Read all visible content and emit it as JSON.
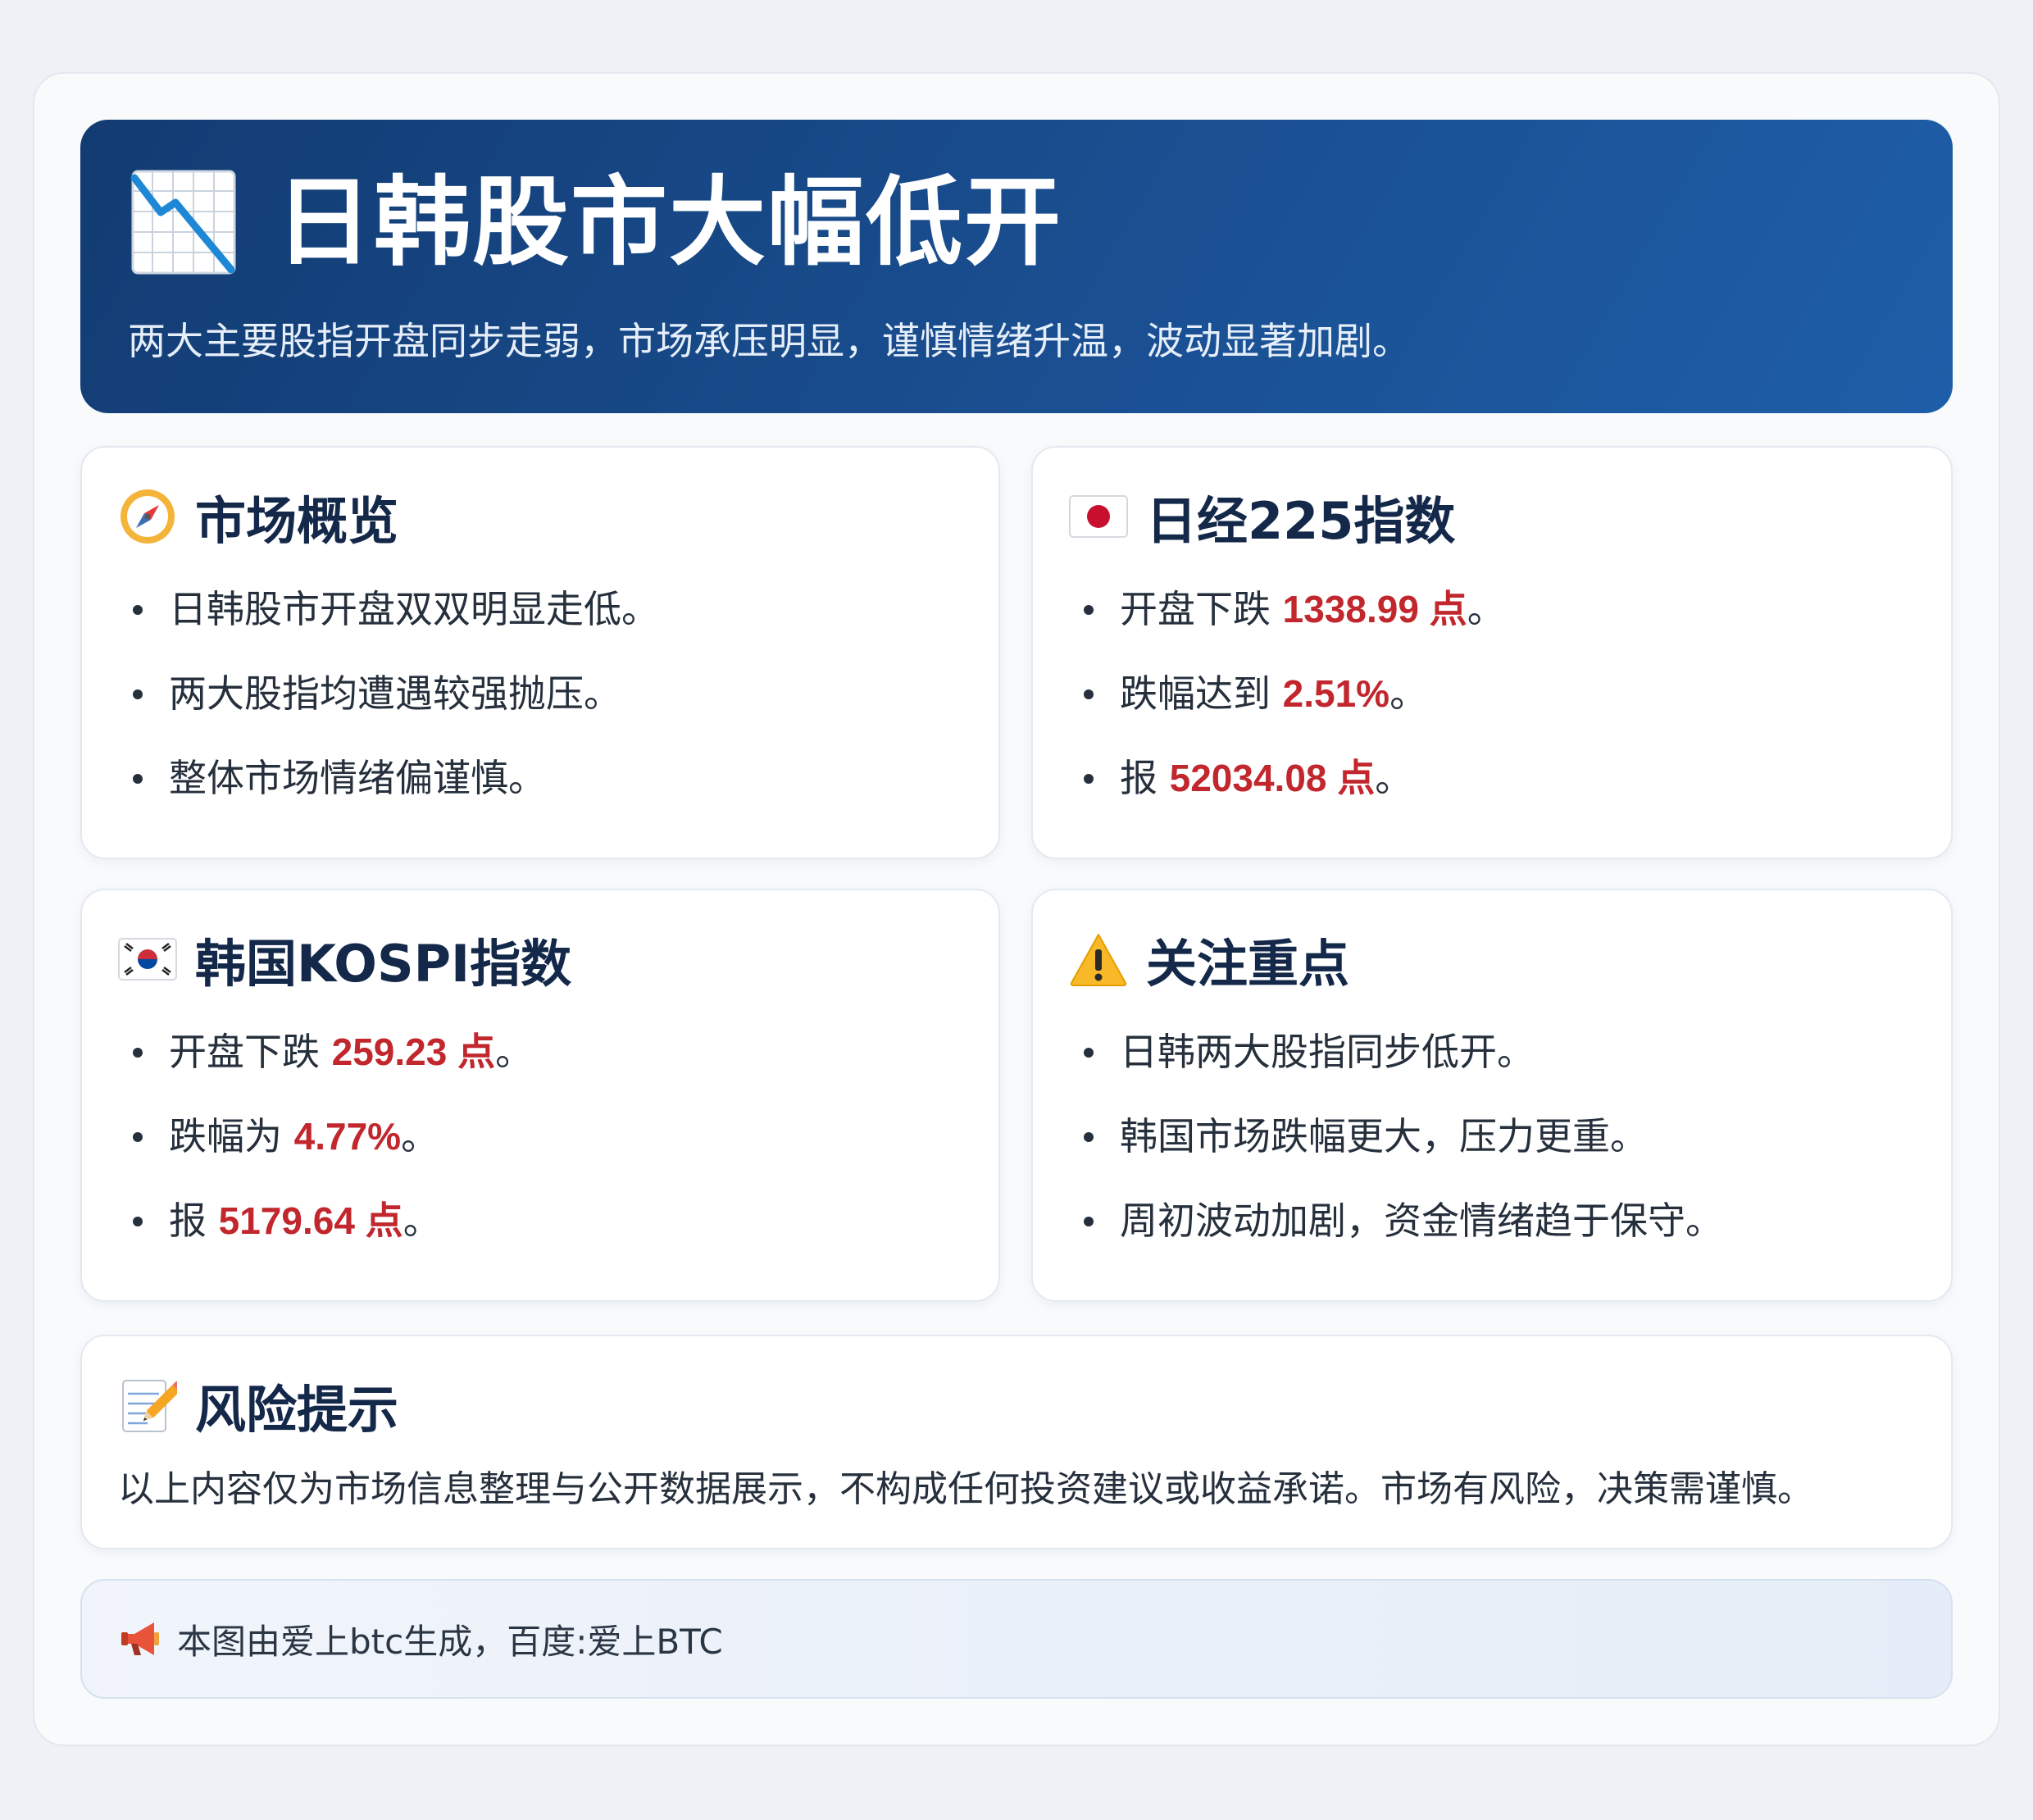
{
  "header": {
    "icon": "chart-decreasing-icon",
    "title": "日韩股市大幅低开",
    "subtitle": "两大主要股指开盘同步走弱，市场承压明显，谨慎情绪升温，波动显著加剧。"
  },
  "overview": {
    "icon": "compass-icon",
    "title": "市场概览",
    "items": [
      "日韩股市开盘双双明显走低。",
      "两大股指均遭遇较强抛压。",
      "整体市场情绪偏谨慎。"
    ]
  },
  "nikkei": {
    "icon": "japan-flag-icon",
    "title": "日经225指数",
    "items": [
      {
        "prefix": "开盘下跌 ",
        "value": "1338.99 点",
        "suffix": "。"
      },
      {
        "prefix": "跌幅达到 ",
        "value": "2.51%",
        "suffix": "。"
      },
      {
        "prefix": "报 ",
        "value": "52034.08 点",
        "suffix": "。"
      }
    ]
  },
  "kospi": {
    "icon": "korea-flag-icon",
    "title": "韩国KOSPI指数",
    "items": [
      {
        "prefix": "开盘下跌 ",
        "value": "259.23 点",
        "suffix": "。"
      },
      {
        "prefix": "跌幅为 ",
        "value": "4.77%",
        "suffix": "。"
      },
      {
        "prefix": "报 ",
        "value": "5179.64 点",
        "suffix": "。"
      }
    ]
  },
  "focus": {
    "icon": "warning-icon",
    "title": "关注重点",
    "items": [
      "日韩两大股指同步低开。",
      "韩国市场跌幅更大，压力更重。",
      "周初波动加剧，资金情绪趋于保守。"
    ]
  },
  "risk": {
    "icon": "memo-icon",
    "title": "风险提示",
    "text": "以上内容仅为市场信息整理与公开数据展示，不构成任何投资建议或收益承诺。市场有风险，决策需谨慎。"
  },
  "footer": {
    "icon": "megaphone-icon",
    "text": "本图由爱上btc生成，百度:爱上BTC"
  },
  "colors": {
    "header_bg": "#1a4f91",
    "highlight": "#c1272d",
    "title_text": "#14284a"
  }
}
